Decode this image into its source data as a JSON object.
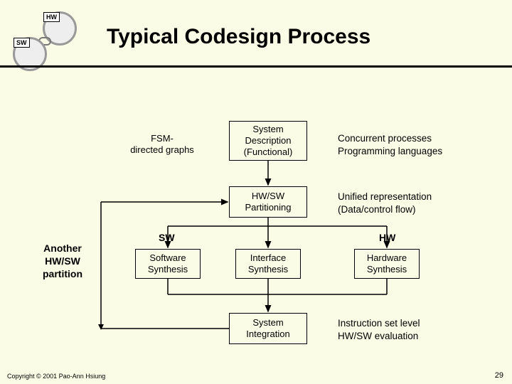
{
  "title": "Typical Codesign Process",
  "emblem": {
    "hw": "HW",
    "sw": "SW"
  },
  "side_label": "Another HW/SW partition",
  "path_labels": {
    "sw": "SW",
    "hw": "HW"
  },
  "boxes": {
    "fsm": "FSM-\ndirected graphs",
    "sysdesc": "System Description (Functional)",
    "partition": "HW/SW Partitioning",
    "swsyn": "Software Synthesis",
    "ifsyn": "Interface Synthesis",
    "hwsyn": "Hardware Synthesis",
    "integ": "System Integration"
  },
  "notes": {
    "desc": "Concurrent processes\nProgramming languages",
    "part": "Unified representation\n(Data/control flow)",
    "integ": "Instruction set level\nHW/SW evaluation"
  },
  "footer": "Copyright © 2001 Pao-Ann Hsiung",
  "page": "29"
}
